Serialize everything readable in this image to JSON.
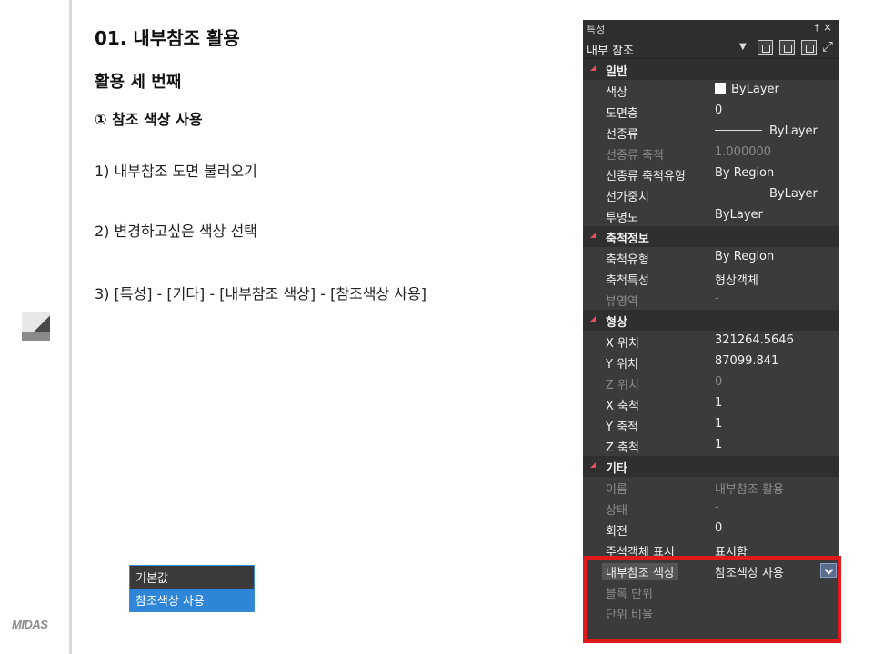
{
  "slide": {
    "title": "01. 내부참조 활용",
    "subtitle": "활용 세 번째",
    "step_heading": "① 참조 색상 사용",
    "steps": [
      "1) 내부참조 도면 불러오기",
      "2) 변경하고싶은 색상 선택",
      "3) [특성] - [기타] - [내부참조 색상] - [참조색상 사용]"
    ],
    "logo": "MIDAS"
  },
  "panel": {
    "title": "특성",
    "pin": "†",
    "close": "×",
    "object_type": "내부 참조",
    "categories": [
      {
        "name": "일반",
        "rows": [
          {
            "label": "색상",
            "value": "ByLayer",
            "dim": false,
            "decor": "swatch"
          },
          {
            "label": "도면층",
            "value": "0",
            "dim": false
          },
          {
            "label": "선종류",
            "value": "ByLayer",
            "dim": false,
            "decor": "line"
          },
          {
            "label": "선종류 축척",
            "value": "1.000000",
            "dim": true
          },
          {
            "label": "선종류 축척유형",
            "value": "By Region",
            "dim": false
          },
          {
            "label": "선가중치",
            "value": "ByLayer",
            "dim": false,
            "decor": "line"
          },
          {
            "label": "투명도",
            "value": "ByLayer",
            "dim": false
          }
        ]
      },
      {
        "name": "축척정보",
        "rows": [
          {
            "label": "축척유형",
            "value": "By Region",
            "dim": false
          },
          {
            "label": "축척특성",
            "value": "형상객체",
            "dim": false
          },
          {
            "label": "뷰영역",
            "value": "-",
            "dim": true
          }
        ]
      },
      {
        "name": "형상",
        "rows": [
          {
            "label": "X 위치",
            "value": "321264.5646",
            "dim": false
          },
          {
            "label": "Y 위치",
            "value": "87099.841",
            "dim": false
          },
          {
            "label": "Z 위치",
            "value": "0",
            "dim": true
          },
          {
            "label": "X 축척",
            "value": "1",
            "dim": false
          },
          {
            "label": "Y 축척",
            "value": "1",
            "dim": false
          },
          {
            "label": "Z 축척",
            "value": "1",
            "dim": false
          }
        ]
      },
      {
        "name": "기타",
        "rows": [
          {
            "label": "이름",
            "value": "내부참조 활용",
            "dim": true
          },
          {
            "label": "상태",
            "value": "-",
            "dim": true
          },
          {
            "label": "회전",
            "value": "0",
            "dim": false
          },
          {
            "label": "주석객체 표시",
            "value": "표시함",
            "dim": false
          },
          {
            "label": "내부참조 색상",
            "value": "참조색상 사용",
            "dim": false,
            "active": true
          },
          {
            "label": "블록 단위",
            "value": "",
            "dim": true
          },
          {
            "label": "단위 비율",
            "value": "",
            "dim": true
          }
        ]
      }
    ],
    "dropdown_options": [
      "기본값",
      "참조색상 사용"
    ],
    "dropdown_selected": "참조색상 사용"
  },
  "colors": {
    "highlight": "#e01a1a",
    "selection": "#2f86d8",
    "panel_bg": "#3b3b3b"
  }
}
